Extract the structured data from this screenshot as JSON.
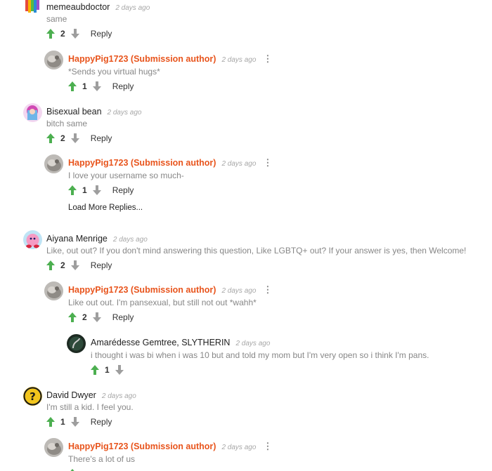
{
  "comments": [
    {
      "author": "memeaubdoctor",
      "time": "2 days ago",
      "text": "same",
      "score": "2",
      "reply": "Reply"
    },
    {
      "author": "HappyPig1723 (Submission author)",
      "time": "2 days ago",
      "text": "*Sends you virtual hugs*",
      "score": "1",
      "reply": "Reply"
    },
    {
      "author": "Bisexual bean",
      "time": "2 days ago",
      "text": "bitch same",
      "score": "2",
      "reply": "Reply"
    },
    {
      "author": "HappyPig1723 (Submission author)",
      "time": "2 days ago",
      "text": "I love your username so much-",
      "score": "1",
      "reply": "Reply"
    },
    {
      "author": "Aiyana Menrige",
      "time": "2 days ago",
      "text": "Like, out out? If you don't mind answering this question, Like LGBTQ+ out? If your answer is yes, then Welcome!",
      "score": "2",
      "reply": "Reply"
    },
    {
      "author": "HappyPig1723 (Submission author)",
      "time": "2 days ago",
      "text": "Like out out. I'm pansexual, but still not out *wahh*",
      "score": "2",
      "reply": "Reply"
    },
    {
      "author": "Amarédesse Gemtree, SLYTHERIN",
      "time": "2 days ago",
      "text": "i thought i was bi when i was 10 but and told my mom but I'm very open so i think I'm pans.",
      "score": "1",
      "reply": ""
    },
    {
      "author": "David Dwyer",
      "time": "2 days ago",
      "text": "I'm still a kid. I feel you.",
      "score": "1",
      "reply": "Reply"
    },
    {
      "author": "HappyPig1723 (Submission author)",
      "time": "2 days ago",
      "text": "There's a lot of us",
      "score": "",
      "reply": ""
    }
  ],
  "load_more": "Load More Replies...",
  "more_icon": "⋮",
  "colors": {
    "upvote": "#4caf50",
    "downvote": "#9e9e9e",
    "op_name": "#e8541c"
  }
}
